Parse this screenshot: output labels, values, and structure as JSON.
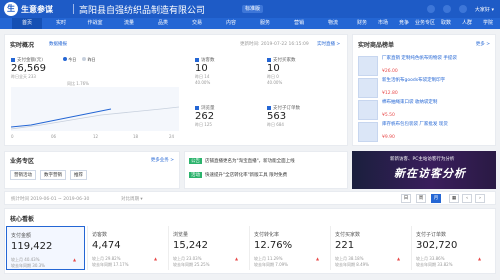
{
  "header": {
    "brand": "生意参谋",
    "company": "高阳县自强纺织品制造有限公司",
    "tag": "标准版",
    "user": "大家好 ▾"
  },
  "nav": {
    "items": [
      {
        "label": "首页",
        "active": true
      },
      {
        "label": "实时"
      },
      {
        "label": "作战室"
      },
      {
        "label": "流量"
      },
      {
        "label": "品类"
      },
      {
        "label": "交易"
      },
      {
        "label": "内容"
      },
      {
        "label": "服务"
      },
      {
        "label": "营销"
      },
      {
        "label": "物流"
      },
      {
        "label": "财务"
      },
      {
        "label": "市场"
      },
      {
        "label": "竞争"
      },
      {
        "label": "业务专区"
      },
      {
        "label": "取数"
      },
      {
        "label": "人群"
      },
      {
        "label": "学院"
      }
    ]
  },
  "realtime": {
    "title": "实时概况",
    "badge": "数据播报",
    "updated": "更新时间: 2019-07-22 16:15:09",
    "link": "实时直播 >",
    "pay_label": "支付金额(元)",
    "pay_value": "26,569",
    "pay_yesterday": "昨日全天 233",
    "pay_extra": "同比 1.76%",
    "legend_today": "今日",
    "legend_yesterday": "昨日",
    "axis_ticks": [
      "0",
      "06",
      "12",
      "18",
      "24"
    ],
    "visitors_label": "访客数",
    "visitors_value": "10",
    "visitors_sub": "昨日 14",
    "buyers_label": "支付买家数",
    "buyers_value": "10",
    "buyers_sub": "昨日 0",
    "pv_label": "浏览量",
    "pv_value": "262",
    "pv_sub": "昨日 125",
    "orders_label": "支付子订单数",
    "orders_value": "563",
    "orders_sub": "昨日 684",
    "pct1": "40.00%",
    "pct2": "40.00%"
  },
  "ranking": {
    "title": "实时商品榜单",
    "link": "更多 >",
    "items": [
      {
        "name": "厂家直销 定制纯色帆布购物袋 手提袋",
        "price": "¥26.00"
      },
      {
        "name": "新生活帆布goods布袋定制印字",
        "price": "¥12.80"
      },
      {
        "name": "棉布抽绳束口袋 收纳袋定制",
        "price": "¥5.50"
      },
      {
        "name": "库存帆布包包装袋 厂家批发 现货",
        "price": "¥9.90"
      }
    ]
  },
  "business": {
    "title": "业务专区",
    "link": "更多业务 >",
    "tabs": [
      "营销活动",
      "数字营销",
      "推荐"
    ]
  },
  "news": {
    "items": [
      {
        "label": "公告",
        "text": "店铺直播更名为\"淘宝直播\"，新功能全面上线"
      },
      {
        "label": "活动",
        "text": "快速提升\"全店转化率\"新版工具 限时免费"
      }
    ]
  },
  "banner": {
    "line1": "新新访客、PC主站访客行为分析",
    "big": "新在访客分析",
    "color_accent": "#ff9a3c"
  },
  "date_bar": {
    "period": "统计时间 2019-06-01 ~ 2019-06-30",
    "compare": "对比周期 ▾",
    "options": [
      "日",
      "周",
      "月"
    ],
    "active_option": "月"
  },
  "core": {
    "title": "核心看板",
    "metrics": [
      {
        "label": "支付金额",
        "value": "119,422",
        "sub1": "较上月 40.43%",
        "sub2": "较去年同期 30.3%",
        "dir": "up"
      },
      {
        "label": "访客数",
        "value": "4,474",
        "sub1": "较上月 29.82%",
        "sub2": "较去年同期 17.17%",
        "dir": "up"
      },
      {
        "label": "浏览量",
        "value": "15,242",
        "sub1": "较上月 23.03%",
        "sub2": "较去年同期 25.25%",
        "dir": "up"
      },
      {
        "label": "支付转化率",
        "value": "12.76%",
        "sub1": "较上月 11.29%",
        "sub2": "较去年同期 7.09%",
        "dir": "up"
      },
      {
        "label": "支付买家数",
        "value": "221",
        "sub1": "较上月 38.18%",
        "sub2": "较去年同期 8.49%",
        "dir": "up"
      },
      {
        "label": "支付子订单数",
        "value": "302,720",
        "sub1": "较上月 33.86%",
        "sub2": "较去年同期 33.82%",
        "dir": "up"
      }
    ]
  },
  "colors": {
    "primary": "#2466d4",
    "up": "#e84a4a",
    "down": "#2bb36c"
  }
}
